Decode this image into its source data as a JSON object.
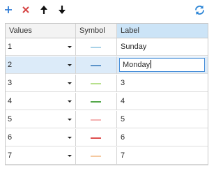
{
  "toolbar": {
    "add_icon": "plus-icon",
    "delete_icon": "x-icon",
    "move_up_icon": "arrow-up-icon",
    "move_down_icon": "arrow-down-icon",
    "refresh_icon": "refresh-icon"
  },
  "colors": {
    "add": "#2e7bd6",
    "delete": "#d64545",
    "arrows": "#111111",
    "refresh": "#2e86d6",
    "header_selected": "#cce4f7",
    "row_selected": "#dcebf9"
  },
  "table": {
    "columns": [
      "Values",
      "Symbol",
      "Label"
    ],
    "selected_column": "Label",
    "rows": [
      {
        "value": "1",
        "symbol_color": "#a9d2e8",
        "label": "Sunday"
      },
      {
        "value": "2",
        "symbol_color": "#5c93c9",
        "label": "Monday",
        "editing": true
      },
      {
        "value": "3",
        "symbol_color": "#b7e08d",
        "label": "3"
      },
      {
        "value": "4",
        "symbol_color": "#55a84b",
        "label": "4"
      },
      {
        "value": "5",
        "symbol_color": "#f4b2b2",
        "label": "5"
      },
      {
        "value": "6",
        "symbol_color": "#df4f4f",
        "label": "6"
      },
      {
        "value": "7",
        "symbol_color": "#f5c9a0",
        "label": "7"
      }
    ]
  }
}
